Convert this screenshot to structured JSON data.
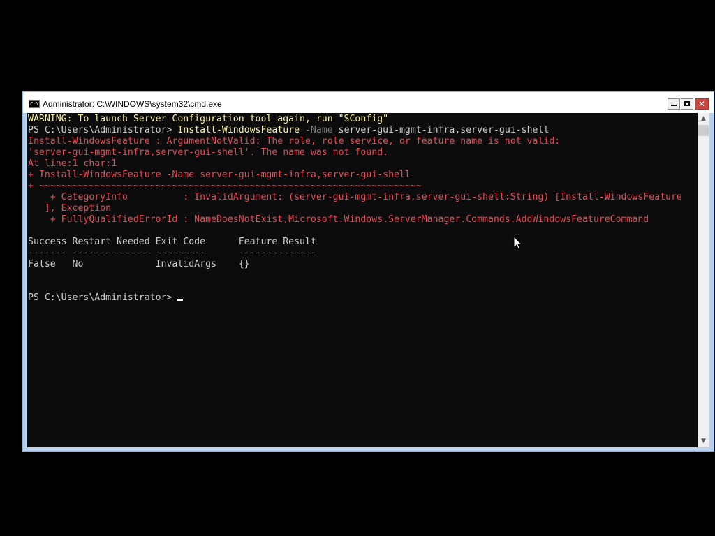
{
  "window": {
    "title": "Administrator: C:\\WINDOWS\\system32\\cmd.exe",
    "icon": "console-app-icon",
    "icon_text": "C:\\",
    "controls": {
      "minimize": "minimize-icon",
      "maximize": "maximize-icon",
      "close": "close-icon",
      "close_glyph": "✕"
    }
  },
  "console": {
    "colors": {
      "background": "#0c0c0c",
      "default_text": "#cccccc",
      "warning": "#f9f1a5",
      "error": "#e74856",
      "parameter": "#767676"
    },
    "warning_line": "WARNING: To launch Server Configuration tool again, run \"SConfig\"",
    "command_line": {
      "prompt": "PS C:\\Users\\Administrator> ",
      "cmdlet": "Install-WindowsFeature",
      "param": " -Name",
      "args": " server-gui-mgmt-infra,server-gui-shell"
    },
    "error_lines": [
      "Install-WindowsFeature : ArgumentNotValid: The role, role service, or feature name is not valid:",
      "'server-gui-mgmt-infra,server-gui-shell'. The name was not found.",
      "At line:1 char:1",
      "+ Install-WindowsFeature -Name server-gui-mgmt-infra,server-gui-shell",
      "+ ~~~~~~~~~~~~~~~~~~~~~~~~~~~~~~~~~~~~~~~~~~~~~~~~~~~~~~~~~~~~~~~~~~~~~",
      "    + CategoryInfo          : InvalidArgument: (server-gui-mgmt-infra,server-gui-shell:String) [Install-WindowsFeature",
      "   ], Exception",
      "    + FullyQualifiedErrorId : NameDoesNotExist,Microsoft.Windows.ServerManager.Commands.AddWindowsFeatureCommand"
    ],
    "result_table": {
      "header": "Success Restart Needed Exit Code      Feature Result",
      "separator": "------- -------------- ---------      --------------",
      "row": "False   No             InvalidArgs    {}"
    },
    "final_prompt": "PS C:\\Users\\Administrator> "
  },
  "scrollbar": {
    "up_arrow": "▲",
    "down_arrow": "▼"
  },
  "pointer": "mouse-pointer-icon"
}
